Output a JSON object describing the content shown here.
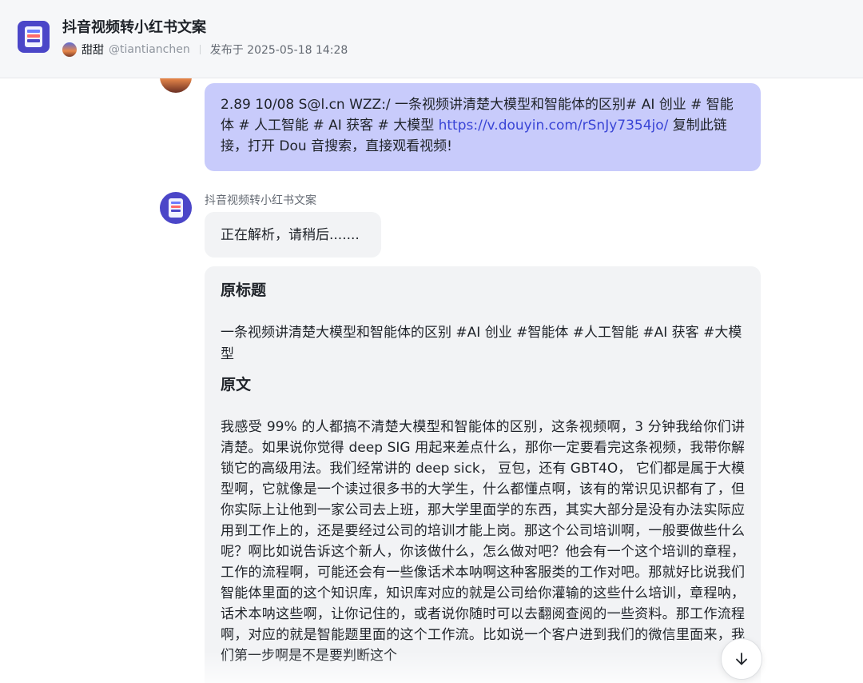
{
  "header": {
    "app_title": "抖音视频转小红书文案",
    "author_name": "甜甜",
    "author_handle": "@tiantianchen",
    "published": "发布于 2025-05-18 14:28"
  },
  "colors": {
    "accent": "#4b46c8",
    "user_bubble": "#c8cbfb",
    "bot_bubble": "#f2f3f5",
    "link": "#3a45d6"
  },
  "user_message": {
    "text_before_link": "2.89 10/08 S@l.cn WZZ:/ 一条视频讲清楚大模型和智能体的区别# AI 创业 # 智能体 # 人工智能 # AI 获客 # 大模型 ",
    "link": "https://v.douyin.com/rSnJy7354jo/",
    "text_after_link": " 复制此链接，打开 Dou 音搜索，直接观看视频!"
  },
  "bot": {
    "name": "抖音视频转小红书文案",
    "status": "正在解析，请稍后.......",
    "section_title_heading": "原标题",
    "original_title": "一条视频讲清楚大模型和智能体的区别 #AI 创业 #智能体 #人工智能 #AI 获客 #大模型",
    "section_body_heading": "原文",
    "original_text": "我感受 99% 的人都搞不清楚大模型和智能体的区别，这条视频啊，3 分钟我给你们讲清楚。如果说你觉得 deep SIG 用起来差点什么，那你一定要看完这条视频，我带你解锁它的高级用法。我们经常讲的 deep sick， 豆包，还有 GBT4O， 它们都是属于大模型啊，它就像是一个读过很多书的大学生，什么都懂点啊，该有的常识见识都有了，但你实际上让他到一家公司去上班，那大学里面学的东西，其实大部分是没有办法实际应用到工作上的，还是要经过公司的培训才能上岗。那这个公司培训啊，一般要做些什么呢？啊比如说告诉这个新人，你该做什么，怎么做对吧？他会有一个这个培训的章程，工作的流程啊，可能还会有一些像话术本呐啊这种客服类的工作对吧。那就好比说我们智能体里面的这个知识库，知识库对应的就是公司给你灌输的这些什么培训，章程呐，话术本呐这些啊，让你记住的，或者说你随时可以去翻阅查阅的一些资料。那工作流程啊，对应的就是智能题里面的这个工作流。比如说一个客户进到我们的微信里面来，我们第一步啊是不是要判断这个"
  },
  "icons": {
    "scroll_down": "arrow-down-icon"
  }
}
